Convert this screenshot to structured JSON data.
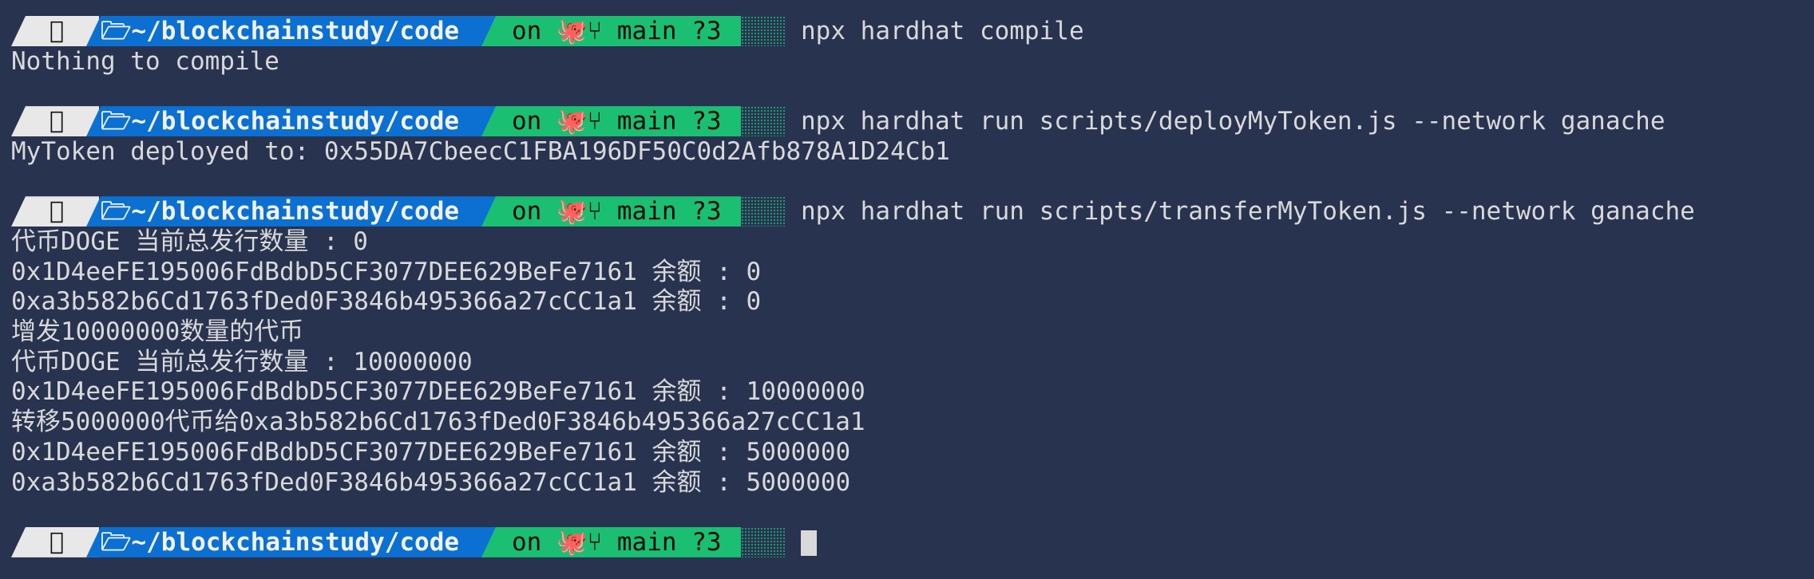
{
  "prompt": {
    "apple_icon": "apple-icon",
    "folder_icon": "folder-open-icon",
    "path": "~/blockchainstudy/code",
    "git_prefix": "on",
    "github_icon": "github-icon",
    "branch_icon": "git-branch-icon",
    "branch": "main",
    "status": "?3"
  },
  "commands": [
    {
      "command": "npx hardhat compile",
      "output": [
        "Nothing to compile"
      ]
    },
    {
      "command": "npx hardhat run scripts/deployMyToken.js --network ganache",
      "output": [
        "MyToken deployed to: 0x55DA7CbeecC1FBA196DF50C0d2Afb878A1D24Cb1"
      ]
    },
    {
      "command": "npx hardhat run scripts/transferMyToken.js --network ganache",
      "output": [
        "代币DOGE 当前总发行数量 : 0",
        "0x1D4eeFE195006FdBdbD5CF3077DEE629BeFe7161 余额 : 0",
        "0xa3b582b6Cd1763fDed0F3846b495366a27cCC1a1 余额 : 0",
        "增发10000000数量的代币",
        "代币DOGE 当前总发行数量 : 10000000",
        "0x1D4eeFE195006FdBdbD5CF3077DEE629BeFe7161 余额 : 10000000",
        "转移5000000代币给0xa3b582b6Cd1763fDed0F3846b495366a27cCC1a1",
        "0x1D4eeFE195006FdBdbD5CF3077DEE629BeFe7161 余额 : 5000000",
        "0xa3b582b6Cd1763fDed0F3846b495366a27cCC1a1 余额 : 5000000"
      ]
    }
  ],
  "colors": {
    "background": "#283350",
    "path_segment": "#0b70d1",
    "git_segment": "#1bbf72",
    "text": "#d9d9d9"
  }
}
